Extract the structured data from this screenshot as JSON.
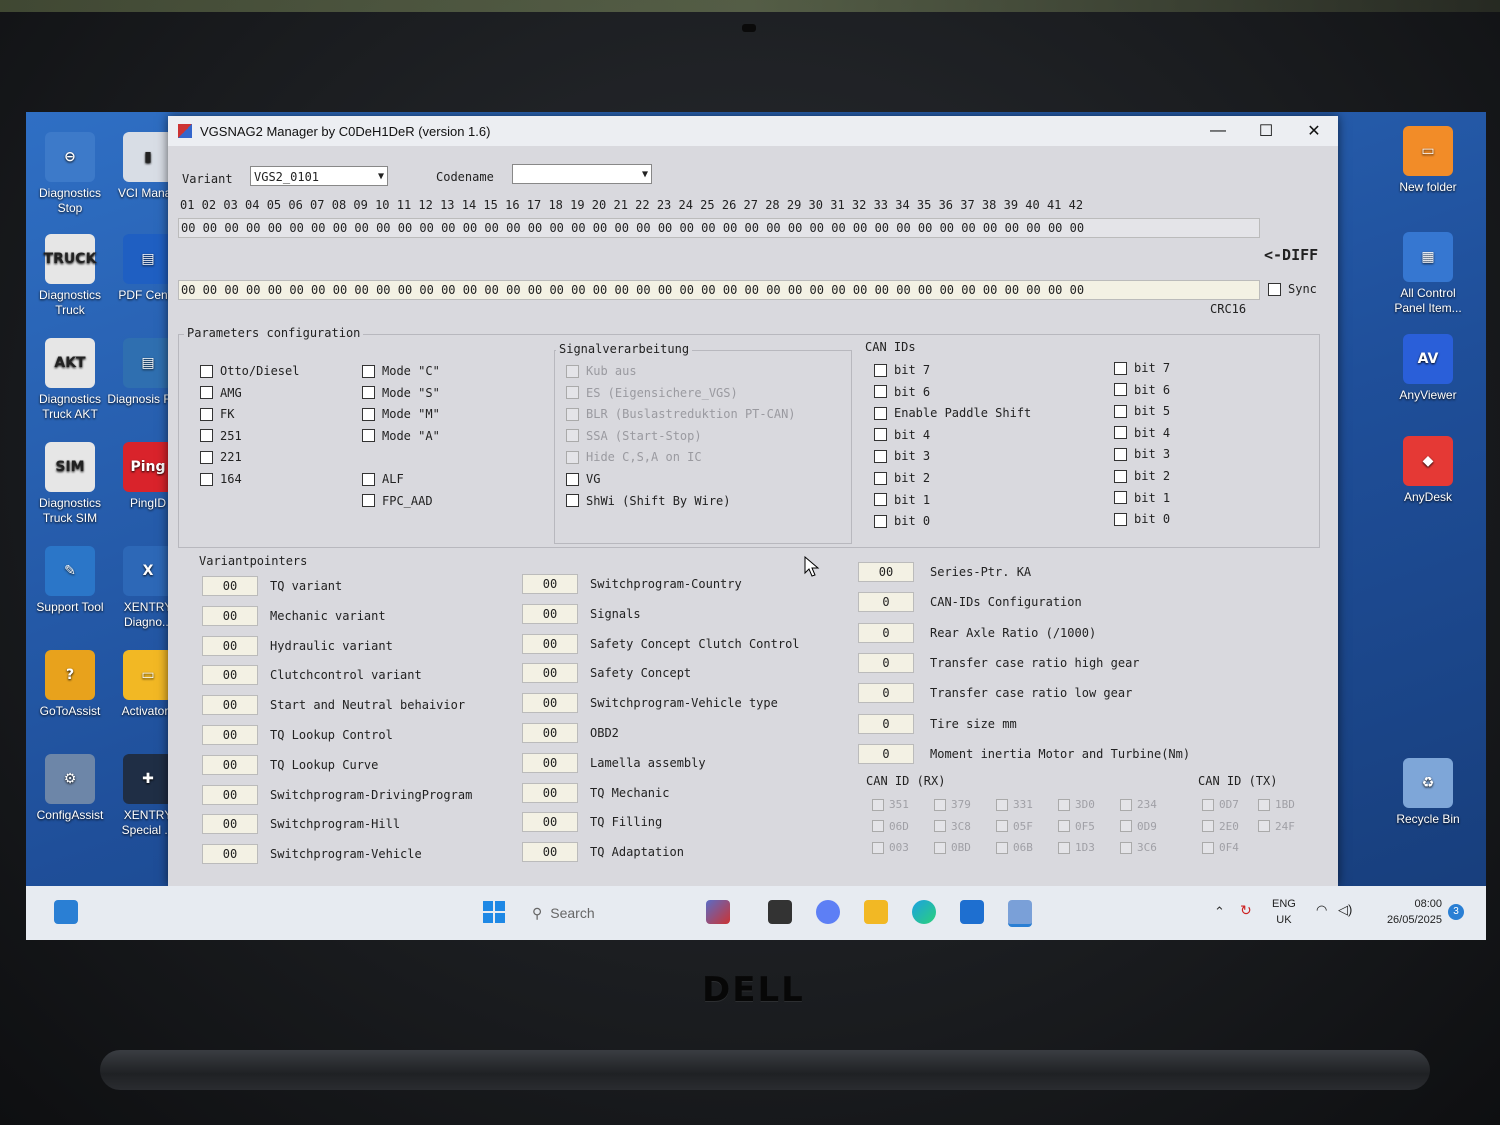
{
  "window": {
    "title": "VGSNAG2 Manager by C0DeH1DeR (version 1.6)",
    "controls": {
      "minimize": "—",
      "maximize": "☐",
      "close": "✕"
    }
  },
  "header": {
    "variant_label": "Variant",
    "variant_value": "VGS2_0101",
    "codename_label": "Codename",
    "codename_value": "",
    "diff_label": "<-DIFF",
    "sync_label": "Sync",
    "crc_label": "CRC16"
  },
  "hex": {
    "indices": "01 02 03 04 05 06 07 08 09 10 11 12 13 14 15 16 17 18 19 20 21 22 23 24 25 26 27 28 29 30 31 32 33 34 35 36 37 38 39 40 41 42",
    "row1": "00 00 00 00 00 00 00 00 00 00 00 00 00 00 00 00 00 00 00 00 00 00 00 00 00 00 00 00 00 00 00 00 00 00 00 00 00 00 00 00 00 00",
    "row2": "00 00 00 00 00 00 00 00 00 00 00 00 00 00 00 00 00 00 00 00 00 00 00 00 00 00 00 00 00 00 00 00 00 00 00 00 00 00 00 00 00 00"
  },
  "params": {
    "title": "Parameters configuration",
    "col1": [
      "Otto/Diesel",
      "AMG",
      "FK",
      "251",
      "221",
      "164"
    ],
    "col2": [
      "Mode \"C\"",
      "Mode \"S\"",
      "Mode \"M\"",
      "Mode \"A\""
    ],
    "col2b": [
      "ALF",
      "FPC_AAD"
    ]
  },
  "signal": {
    "title": "Signalverarbeitung",
    "items": [
      "Kub aus",
      "ES (Eigensichere_VGS)",
      "BLR (Buslastreduktion PT-CAN)",
      "SSA (Start-Stop)",
      "Hide C,S,A on IC",
      "VG",
      "ShWi (Shift By Wire)"
    ]
  },
  "canids": {
    "title": "CAN IDs",
    "left": [
      "bit 7",
      "bit 6",
      "Enable Paddle Shift",
      "bit 4",
      "bit 3",
      "bit 2",
      "bit 1",
      "bit 0"
    ],
    "right": [
      "bit 7",
      "bit 6",
      "bit 5",
      "bit 4",
      "bit 3",
      "bit 2",
      "bit 1",
      "bit 0"
    ]
  },
  "variantpointers": {
    "title": "Variantpointers",
    "col1": [
      {
        "value": "00",
        "label": "TQ variant"
      },
      {
        "value": "00",
        "label": "Mechanic variant"
      },
      {
        "value": "00",
        "label": "Hydraulic variant"
      },
      {
        "value": "00",
        "label": "Clutchcontrol variant"
      },
      {
        "value": "00",
        "label": "Start and Neutral behaivior"
      },
      {
        "value": "00",
        "label": "TQ Lookup Control"
      },
      {
        "value": "00",
        "label": "TQ Lookup Curve"
      },
      {
        "value": "00",
        "label": "Switchprogram-DrivingProgram"
      },
      {
        "value": "00",
        "label": "Switchprogram-Hill"
      },
      {
        "value": "00",
        "label": "Switchprogram-Vehicle"
      }
    ],
    "col2": [
      {
        "value": "00",
        "label": "Switchprogram-Country"
      },
      {
        "value": "00",
        "label": "Signals"
      },
      {
        "value": "00",
        "label": "Safety Concept Clutch Control"
      },
      {
        "value": "00",
        "label": "Safety Concept"
      },
      {
        "value": "00",
        "label": "Switchprogram-Vehicle type"
      },
      {
        "value": "00",
        "label": "OBD2"
      },
      {
        "value": "00",
        "label": "Lamella assembly"
      },
      {
        "value": "00",
        "label": "TQ Mechanic"
      },
      {
        "value": "00",
        "label": "TQ Filling"
      },
      {
        "value": "00",
        "label": "TQ Adaptation"
      }
    ],
    "col3": [
      {
        "value": "00",
        "label": "Series-Ptr. KA"
      },
      {
        "value": "0",
        "label": "CAN-IDs Configuration"
      },
      {
        "value": "0",
        "label": "Rear Axle Ratio (/1000)"
      },
      {
        "value": "0",
        "label": "Transfer case ratio high gear"
      },
      {
        "value": "0",
        "label": "Transfer case ratio low gear"
      },
      {
        "value": "0",
        "label": "Tire size mm"
      },
      {
        "value": "0",
        "label": "Moment inertia Motor and Turbine(Nm)"
      }
    ]
  },
  "canrx": {
    "title": "CAN ID (RX)",
    "rows": [
      [
        "351",
        "379",
        "331",
        "3D0",
        "234"
      ],
      [
        "06D",
        "3C8",
        "05F",
        "0F5",
        "0D9"
      ],
      [
        "003",
        "0BD",
        "06B",
        "1D3",
        "3C6"
      ]
    ]
  },
  "cantx": {
    "title": "CAN ID (TX)",
    "rows": [
      [
        "0D7",
        "1BD"
      ],
      [
        "2E0",
        "24F"
      ],
      [
        "0F4"
      ]
    ]
  },
  "desktop": {
    "icons": [
      {
        "label": "Diagnostics Stop",
        "glyph": "⊖"
      },
      {
        "label": "VCI Manag",
        "glyph": "▮"
      },
      {
        "label": "Diagnostics Truck",
        "glyph": "TRUCK"
      },
      {
        "label": "PDF Cente",
        "glyph": "▤"
      },
      {
        "label": "Diagnostics Truck AKT",
        "glyph": "AKT"
      },
      {
        "label": "Diagnosis Files",
        "glyph": "▤"
      },
      {
        "label": "Diagnostics Truck SIM",
        "glyph": "SIM"
      },
      {
        "label": "PingID",
        "glyph": "Ping"
      },
      {
        "label": "Support Tool",
        "glyph": "✎"
      },
      {
        "label": "XENTRY Diagno...",
        "glyph": "X"
      },
      {
        "label": "GoToAssist",
        "glyph": "?"
      },
      {
        "label": "Activators",
        "glyph": "▭"
      },
      {
        "label": "ConfigAssist",
        "glyph": "⚙"
      },
      {
        "label": "XENTRY Special ...",
        "glyph": "✚"
      },
      {
        "label": "New folder",
        "glyph": "▭"
      },
      {
        "label": "All Control Panel Item...",
        "glyph": "▦"
      },
      {
        "label": "AnyViewer",
        "glyph": "AV"
      },
      {
        "label": "AnyDesk",
        "glyph": "◆"
      },
      {
        "label": "Recycle Bin",
        "glyph": "♻"
      }
    ]
  },
  "taskbar": {
    "search_placeholder": "Search",
    "lang": "ENG",
    "region": "UK",
    "time": "08:00",
    "date": "26/05/2025",
    "notif_count": "3"
  },
  "brand": "DELL"
}
